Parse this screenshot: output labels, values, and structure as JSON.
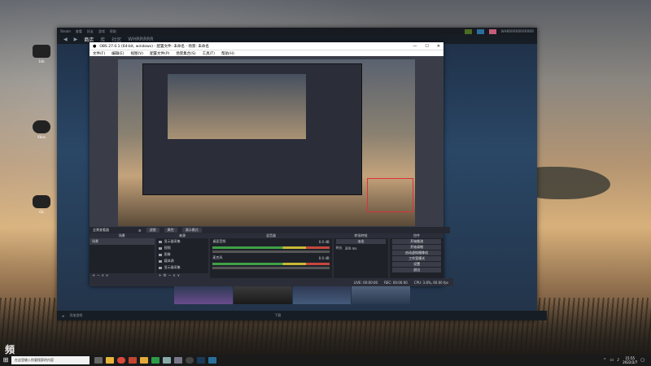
{
  "desktop": {
    "icons": [
      {
        "label": "1kb",
        "icon": "handheld-icon"
      },
      {
        "label": "Xbox",
        "icon": "gamepad-icon"
      },
      {
        "label": "Gb",
        "icon": "controller-icon"
      }
    ]
  },
  "steam": {
    "topbar": {
      "menu": [
        "Steam",
        "查看",
        "好友",
        "游戏",
        "帮助"
      ],
      "user": "WHRRRRRRRRRRRR"
    },
    "nav": {
      "store": "商店",
      "library": "库",
      "community": "社区",
      "username": "WHRRRRR"
    },
    "bottom": {
      "add_game": "添加游戏",
      "downloads": "下载"
    }
  },
  "obs": {
    "title": "OBS 27.0.1 (64-bit, windows) - 配置文件: 未命名 - 场景: 未命名",
    "window_controls": [
      "—",
      "☐",
      "✕"
    ],
    "menu": [
      "文件(F)",
      "编辑(E)",
      "视图(V)",
      "配置文件(P)",
      "场景集合(S)",
      "工具(T)",
      "帮助(H)"
    ],
    "docks_bar": {
      "label": "全景查看器",
      "tab_filters": "滤镜",
      "tab_properties": "属性",
      "tab_studio": "演示模式"
    },
    "scenes": {
      "header": "场景",
      "items": [
        "场景"
      ],
      "footer": "+ − ∧ ∨"
    },
    "sources": {
      "header": "来源",
      "items": [
        "显示器采集",
        "视频",
        "图像",
        "媒体源",
        "显示器采集"
      ],
      "footer": "+ ⚙ − ∧ ∨"
    },
    "mixer": {
      "header": "混音器",
      "channels": [
        {
          "name": "桌面音频",
          "db": "0.0 dB"
        },
        {
          "name": "麦克风",
          "db": "0.0 dB"
        }
      ]
    },
    "transitions": {
      "header": "转场特效",
      "type": "淡出",
      "duration_label": "时长",
      "duration": "300 ms"
    },
    "controls": {
      "header": "控件",
      "buttons": [
        "开始推流",
        "开始录制",
        "启动虚拟摄像机",
        "工作室模式",
        "设置",
        "退出"
      ]
    },
    "status": {
      "live": "LIVE: 00:00:00",
      "rec": "REC: 00:00:00",
      "cpu": "CPU: 3.8%, 60.00 fps"
    }
  },
  "taskbar": {
    "search_placeholder": "在这里输入你要搜索的内容",
    "time": "15:55",
    "date": "2022/2/7"
  },
  "watermark": "頻"
}
